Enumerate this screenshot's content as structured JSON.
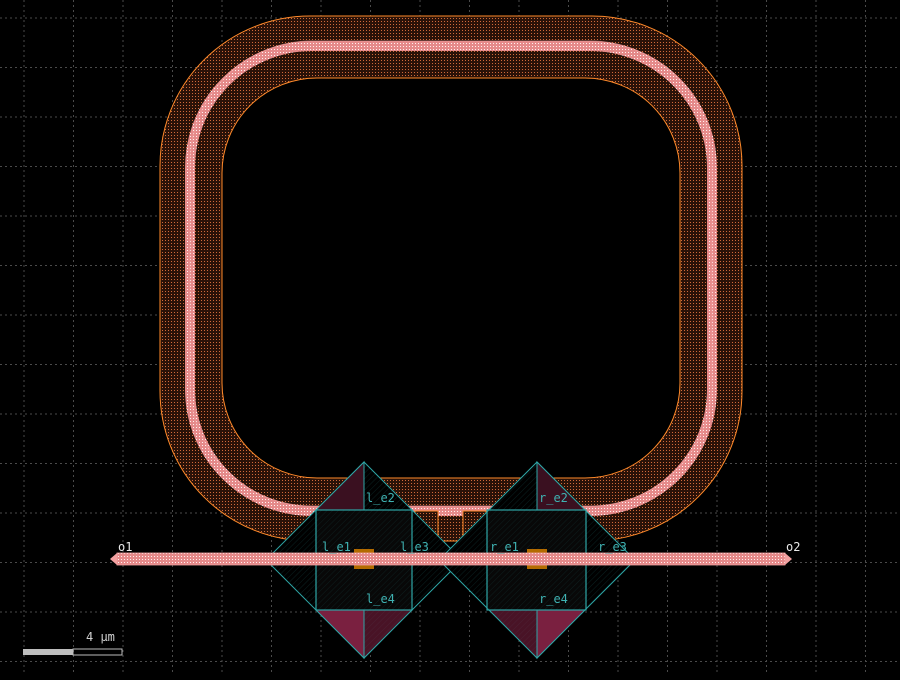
{
  "viewer": {
    "background": "#000000",
    "grid_color": "#4a4a4a"
  },
  "colors": {
    "waveguide": "#f2a0a0",
    "cladding_outline": "#ff8a2a",
    "cladding_fill": "#5a3020",
    "heater_outline": "#2ea6a6",
    "via": "#b36b00",
    "pad_fill": "#7a2040"
  },
  "ports": {
    "o1": "o1",
    "o2": "o2",
    "l_e1": "l_e1",
    "l_e2": "l_e2",
    "l_e3": "l_e3",
    "l_e4": "l_e4",
    "r_e1": "r_e1",
    "r_e2": "r_e2",
    "r_e3": "r_e3",
    "r_e4": "r_e4"
  },
  "scale_bar": {
    "label": "4 μm"
  },
  "layers": {
    "ring": "ring-waveguide",
    "bus": "bus-waveguide",
    "heaters": "heater-pads"
  }
}
